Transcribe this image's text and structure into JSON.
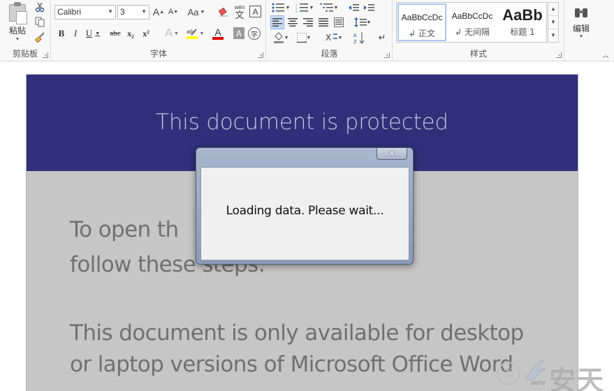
{
  "ribbon": {
    "clipboard": {
      "paste_label": "粘贴",
      "group_label": "剪贴板"
    },
    "font": {
      "font_name": "Calibri",
      "font_size": "3",
      "group_label": "字体",
      "bold": "B",
      "italic": "I",
      "underline": "U",
      "strikethrough": "abc",
      "subscript": "x₂",
      "superscript": "x²",
      "grow": "A",
      "shrink": "A",
      "change_case": "Aa",
      "phonetic": "wén",
      "char_border": "A",
      "text_effects": "A",
      "font_color": "A",
      "char_shading": "A",
      "enclose": "字"
    },
    "paragraph": {
      "group_label": "段落"
    },
    "styles": {
      "group_label": "样式",
      "items": [
        {
          "sample": "AaBbCcDc",
          "name": "↲ 正文"
        },
        {
          "sample": "AaBbCcDc",
          "name": "↲ 无间隔"
        },
        {
          "sample": "AaBb",
          "name": "标题 1"
        }
      ]
    },
    "editing": {
      "label": "编辑"
    }
  },
  "document": {
    "banner_title": "This document is protected",
    "para1_line1": "To open th",
    "para1_line2": "follow these steps:",
    "para2_line1": "This document is only available for desktop",
    "para2_line2": "or laptop versions of Microsoft Office Word"
  },
  "dialog": {
    "close_glyph": "✕",
    "message": "Loading data. Please wait..."
  },
  "watermark": {
    "text": "安天",
    "small": "ANTIY",
    "copyright": "©"
  },
  "colors": {
    "banner": "#2f3079",
    "page_bg": "#c6c6c6",
    "highlight_yellow": "#ffff00",
    "font_red": "#e00000"
  }
}
